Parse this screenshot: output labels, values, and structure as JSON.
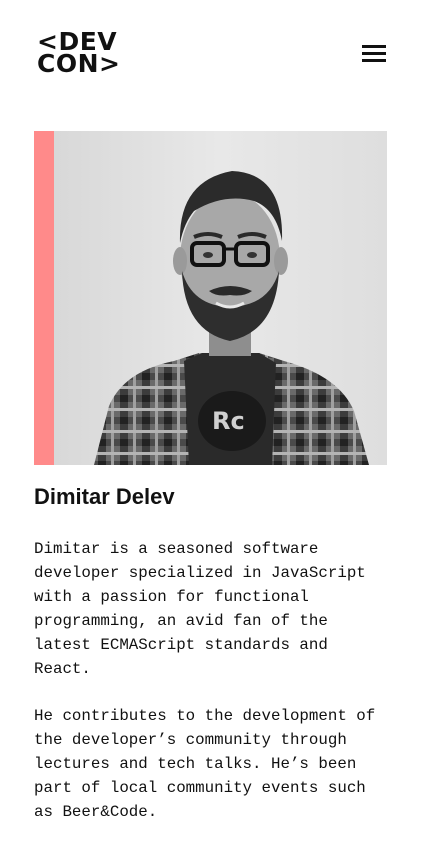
{
  "header": {
    "logo_line1": "<DEV",
    "logo_line2": "CON>",
    "menu_icon": "hamburger-menu-icon"
  },
  "speaker": {
    "name": "Dimitar Delev",
    "accent_color": "#ff8a8a",
    "photo_style": "grayscale",
    "bio": [
      "Dimitar is a seasoned software developer specialized in JavaScript with a passion for functional programming, an avid fan of the latest ECMAScript standards and React.",
      "He contributes to the development of the developer’s community through lectures and tech talks. He’s been part of local community events such as Beer&Code."
    ]
  }
}
